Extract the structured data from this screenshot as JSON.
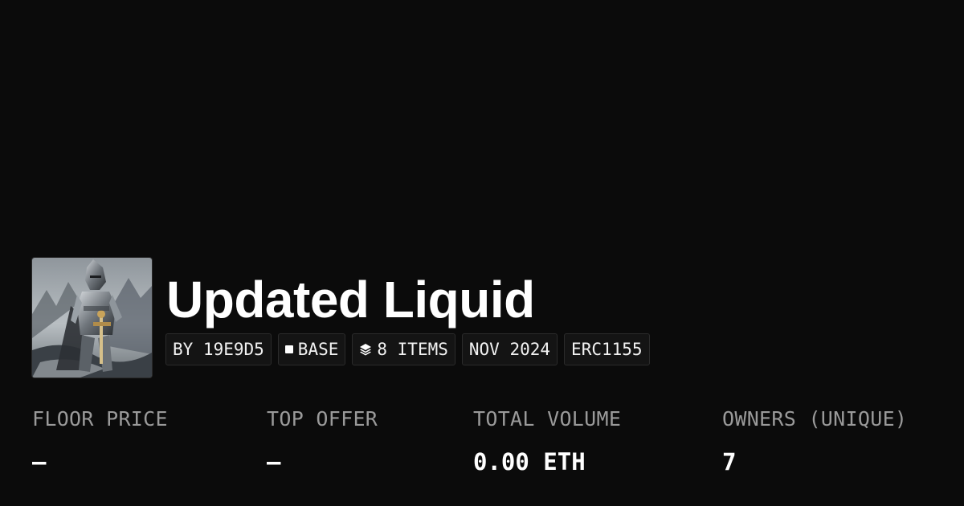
{
  "collection": {
    "name": "Updated Liquid",
    "image_alt": "armored knight with sword"
  },
  "chips": {
    "creator": "BY 19E9D5",
    "chain": "BASE",
    "chain_icon": "square-icon",
    "items": "8 ITEMS",
    "items_icon": "layers-icon",
    "date": "NOV 2024",
    "standard": "ERC1155"
  },
  "stats": {
    "floor_price": {
      "label": "FLOOR PRICE",
      "value": "–"
    },
    "top_offer": {
      "label": "TOP OFFER",
      "value": "–"
    },
    "total_volume": {
      "label": "TOTAL VOLUME",
      "value": "0.00 ETH"
    },
    "owners": {
      "label": "OWNERS (UNIQUE)",
      "value": "7"
    }
  },
  "colors": {
    "background": "#0b0b0b",
    "text": "#ffffff",
    "muted": "#9a9a9a",
    "chip_bg": "#141414",
    "chip_border": "#2b2b2b"
  }
}
